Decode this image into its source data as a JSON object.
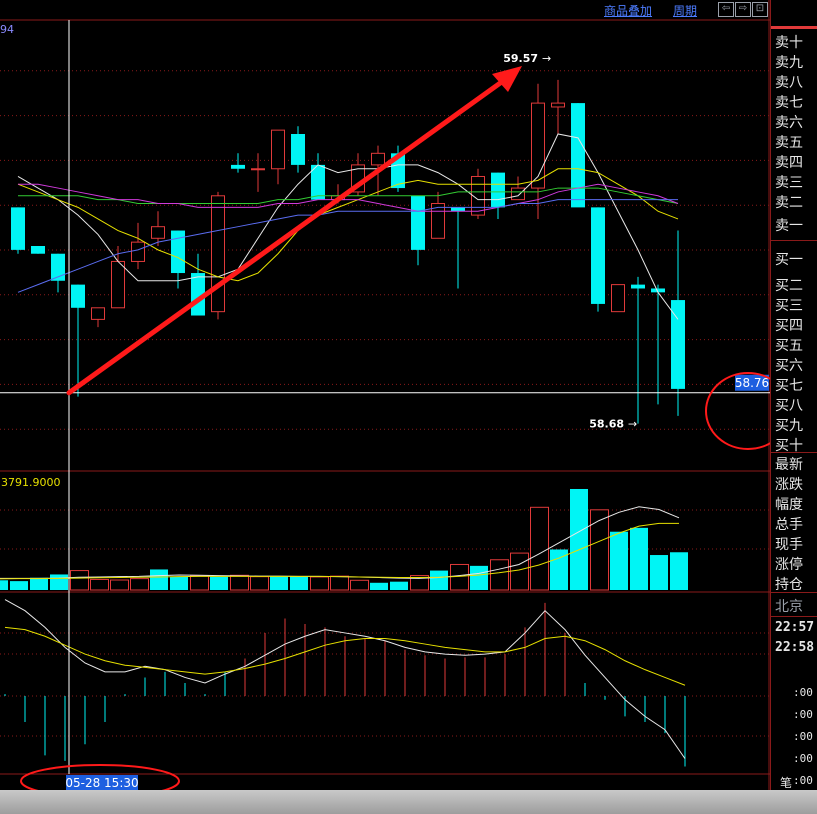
{
  "toolbar": {
    "overlay_label": "商品叠加",
    "period_label": "周期",
    "nav_left": "⇦",
    "nav_right": "⇨",
    "nav_max": "⊡"
  },
  "colors": {
    "up": "#e03a3a",
    "down": "#00f5f5",
    "grid": "#8a1a1a",
    "crosshair": "#ffffff",
    "annot": "#ff1a1a",
    "ma_white": "#e8e8e8",
    "ma_yellow": "#e6e000",
    "ma_purple": "#d03adc",
    "ma_green": "#33cc33",
    "ma_blue": "#5a6cf0"
  },
  "chart_data": {
    "type": "candlestick",
    "price_panel": {
      "ylim": [
        58.56,
        59.72
      ],
      "left_label_partial": "94",
      "max_label": "59.57",
      "min_label": "58.68",
      "crosshair_price_label": "58.76",
      "candles": [
        {
          "o": 59.24,
          "h": 59.24,
          "l": 59.12,
          "c": 59.13
        },
        {
          "o": 59.14,
          "h": 59.14,
          "l": 59.12,
          "c": 59.12
        },
        {
          "o": 59.12,
          "h": 59.12,
          "l": 59.02,
          "c": 59.05
        },
        {
          "o": 59.04,
          "h": 59.04,
          "l": 58.75,
          "c": 58.98
        },
        {
          "o": 58.95,
          "h": 58.98,
          "l": 58.93,
          "c": 58.98
        },
        {
          "o": 58.98,
          "h": 59.14,
          "l": 58.98,
          "c": 59.1
        },
        {
          "o": 59.1,
          "h": 59.2,
          "l": 59.08,
          "c": 59.15
        },
        {
          "o": 59.16,
          "h": 59.23,
          "l": 59.14,
          "c": 59.19
        },
        {
          "o": 59.18,
          "h": 59.18,
          "l": 59.03,
          "c": 59.07
        },
        {
          "o": 59.07,
          "h": 59.12,
          "l": 58.96,
          "c": 58.96
        },
        {
          "o": 58.97,
          "h": 59.28,
          "l": 58.95,
          "c": 59.27
        },
        {
          "o": 59.35,
          "h": 59.38,
          "l": 59.33,
          "c": 59.34
        },
        {
          "o": 59.34,
          "h": 59.38,
          "l": 59.28,
          "c": 59.34
        },
        {
          "o": 59.34,
          "h": 59.42,
          "l": 59.3,
          "c": 59.44
        },
        {
          "o": 59.43,
          "h": 59.45,
          "l": 59.33,
          "c": 59.35
        },
        {
          "o": 59.35,
          "h": 59.38,
          "l": 59.29,
          "c": 59.26
        },
        {
          "o": 59.26,
          "h": 59.3,
          "l": 59.25,
          "c": 59.27
        },
        {
          "o": 59.28,
          "h": 59.38,
          "l": 59.27,
          "c": 59.35
        },
        {
          "o": 59.35,
          "h": 59.4,
          "l": 59.27,
          "c": 59.38
        },
        {
          "o": 59.38,
          "h": 59.4,
          "l": 59.28,
          "c": 59.29
        },
        {
          "o": 59.27,
          "h": 59.27,
          "l": 59.09,
          "c": 59.13
        },
        {
          "o": 59.16,
          "h": 59.28,
          "l": 59.16,
          "c": 59.25
        },
        {
          "o": 59.24,
          "h": 59.24,
          "l": 59.03,
          "c": 59.23
        },
        {
          "o": 59.22,
          "h": 59.34,
          "l": 59.21,
          "c": 59.32
        },
        {
          "o": 59.33,
          "h": 59.33,
          "l": 59.21,
          "c": 59.24
        },
        {
          "o": 59.26,
          "h": 59.32,
          "l": 59.27,
          "c": 59.29
        },
        {
          "o": 59.29,
          "h": 59.56,
          "l": 59.21,
          "c": 59.51
        },
        {
          "o": 59.5,
          "h": 59.57,
          "l": 59.43,
          "c": 59.51
        },
        {
          "o": 59.51,
          "h": 59.51,
          "l": 59.25,
          "c": 59.24
        },
        {
          "o": 59.24,
          "h": 59.24,
          "l": 58.97,
          "c": 58.99
        },
        {
          "o": 58.97,
          "h": 59.04,
          "l": 58.97,
          "c": 59.04
        },
        {
          "o": 59.04,
          "h": 59.06,
          "l": 58.68,
          "c": 59.03
        },
        {
          "o": 59.03,
          "h": 59.04,
          "l": 58.73,
          "c": 59.02
        },
        {
          "o": 59.0,
          "h": 59.18,
          "l": 58.7,
          "c": 58.77
        }
      ],
      "ma_lines": [
        {
          "name": "ma-white",
          "values": [
            59.32,
            59.29,
            59.26,
            59.22,
            59.17,
            59.1,
            59.05,
            59.05,
            59.05,
            59.06,
            59.06,
            59.08,
            59.16,
            59.24,
            59.3,
            59.35,
            59.33,
            59.34,
            59.34,
            59.35,
            59.35,
            59.33,
            59.3,
            59.26,
            59.26,
            59.27,
            59.32,
            59.43,
            59.42,
            59.33,
            59.23,
            59.13,
            59.02,
            58.95
          ]
        },
        {
          "name": "ma-yellow",
          "values": [
            59.3,
            59.28,
            59.26,
            59.24,
            59.21,
            59.18,
            59.16,
            59.13,
            59.11,
            59.08,
            59.06,
            59.05,
            59.07,
            59.12,
            59.18,
            59.22,
            59.24,
            59.26,
            59.28,
            59.3,
            59.31,
            59.3,
            59.3,
            59.3,
            59.3,
            59.3,
            59.31,
            59.34,
            59.34,
            59.33,
            59.3,
            59.27,
            59.23,
            59.21
          ]
        },
        {
          "name": "ma-green",
          "values": [
            59.27,
            59.27,
            59.27,
            59.27,
            59.26,
            59.26,
            59.25,
            59.25,
            59.25,
            59.25,
            59.25,
            59.25,
            59.25,
            59.26,
            59.26,
            59.27,
            59.27,
            59.27,
            59.27,
            59.27,
            59.27,
            59.27,
            59.28,
            59.28,
            59.28,
            59.28,
            59.28,
            59.29,
            59.29,
            59.29,
            59.28,
            59.27,
            59.26,
            59.25
          ]
        },
        {
          "name": "ma-purple",
          "values": [
            59.3,
            59.3,
            59.29,
            59.28,
            59.27,
            59.26,
            59.26,
            59.25,
            59.25,
            59.24,
            59.24,
            59.24,
            59.24,
            59.25,
            59.25,
            59.26,
            59.26,
            59.26,
            59.25,
            59.24,
            59.23,
            59.23,
            59.23,
            59.23,
            59.24,
            59.25,
            59.26,
            59.28,
            59.29,
            59.3,
            59.29,
            59.28,
            59.27,
            59.25
          ]
        },
        {
          "name": "ma-blue",
          "values": [
            59.02,
            59.04,
            59.06,
            59.08,
            59.1,
            59.12,
            59.13,
            59.15,
            59.16,
            59.17,
            59.18,
            59.19,
            59.2,
            59.21,
            59.22,
            59.22,
            59.23,
            59.23,
            59.23,
            59.23,
            59.23,
            59.24,
            59.24,
            59.24,
            59.24,
            59.25,
            59.25,
            59.26,
            59.26,
            59.26,
            59.26,
            59.26,
            59.26,
            59.26
          ]
        }
      ]
    },
    "volume_panel": {
      "label": "3791.9000",
      "ylim": [
        0,
        4000
      ],
      "values": [
        350,
        320,
        440,
        560,
        700,
        380,
        360,
        410,
        740,
        480,
        520,
        480,
        530,
        480,
        500,
        490,
        470,
        500,
        350,
        260,
        300,
        520,
        700,
        920,
        870,
        1090,
        1330,
        2980,
        1460,
        3640,
        2890,
        2100,
        2240,
        1260,
        1360
      ],
      "ma_lines": [
        {
          "name": "vol-ma-white",
          "values": [
            420,
            420,
            420,
            430,
            460,
            470,
            480,
            490,
            520,
            540,
            530,
            520,
            510,
            500,
            500,
            490,
            490,
            480,
            470,
            450,
            430,
            420,
            450,
            520,
            600,
            750,
            920,
            1300,
            1700,
            2100,
            2500,
            2800,
            3000,
            2900,
            2600
          ]
        },
        {
          "name": "vol-ma-yellow",
          "values": [
            400,
            410,
            410,
            420,
            430,
            440,
            450,
            460,
            470,
            480,
            490,
            490,
            490,
            490,
            490,
            490,
            490,
            480,
            470,
            460,
            450,
            450,
            460,
            490,
            540,
            620,
            720,
            900,
            1150,
            1450,
            1750,
            2050,
            2300,
            2400,
            2400
          ]
        }
      ]
    },
    "indicator_panel": {
      "ylim": [
        -1.0,
        0.6
      ],
      "values": [
        -0.3,
        -0.55,
        -0.85,
        -0.9,
        -0.75,
        -0.55,
        -0.3,
        -0.15,
        -0.1,
        -0.2,
        -0.3,
        -0.1,
        0.02,
        0.25,
        0.38,
        0.33,
        0.3,
        0.22,
        0.2,
        0.18,
        0.1,
        0.05,
        0.02,
        0.03,
        0.03,
        0.06,
        0.3,
        0.52,
        0.25,
        -0.2,
        -0.35,
        -0.5,
        -0.55,
        -0.65,
        -0.95
      ],
      "ma_lines": [
        {
          "name": "ind-ma-white",
          "values": [
            0.55,
            0.45,
            0.3,
            0.12,
            -0.02,
            -0.1,
            -0.1,
            -0.05,
            -0.08,
            -0.15,
            -0.2,
            -0.12,
            -0.05,
            0.05,
            0.15,
            0.22,
            0.28,
            0.25,
            0.22,
            0.18,
            0.12,
            0.08,
            0.06,
            0.05,
            0.06,
            0.08,
            0.25,
            0.45,
            0.28,
            0.05,
            -0.15,
            -0.35,
            -0.5,
            -0.62,
            -0.88
          ]
        },
        {
          "name": "ind-ma-yellow",
          "values": [
            0.3,
            0.28,
            0.22,
            0.14,
            0.06,
            0.0,
            -0.04,
            -0.06,
            -0.08,
            -0.1,
            -0.12,
            -0.1,
            -0.07,
            -0.03,
            0.02,
            0.08,
            0.14,
            0.18,
            0.2,
            0.2,
            0.18,
            0.15,
            0.12,
            0.1,
            0.08,
            0.08,
            0.12,
            0.2,
            0.22,
            0.18,
            0.1,
            0.0,
            -0.08,
            -0.15,
            -0.22
          ]
        }
      ]
    },
    "crosshair": {
      "index": 3,
      "price": 58.76
    },
    "x_cursor_label": "05-28 15:30"
  },
  "sidebar": {
    "sell_labels": [
      "卖十",
      "卖九",
      "卖八",
      "卖七",
      "卖六",
      "卖五",
      "卖四",
      "卖三",
      "卖二",
      "卖一"
    ],
    "buy_labels": [
      "买一",
      "买二",
      "买三",
      "买四",
      "买五",
      "买六",
      "买七",
      "买八",
      "买九",
      "买十"
    ],
    "info_labels": [
      "最新",
      "涨跌",
      "幅度",
      "总手",
      "现手",
      "涨停",
      "持仓"
    ],
    "city": "北京",
    "times": [
      "22:57",
      "22:58"
    ],
    "tick_rows": [
      ":00",
      ":00",
      ":00",
      ":00",
      ":00"
    ],
    "tab": "笔"
  }
}
